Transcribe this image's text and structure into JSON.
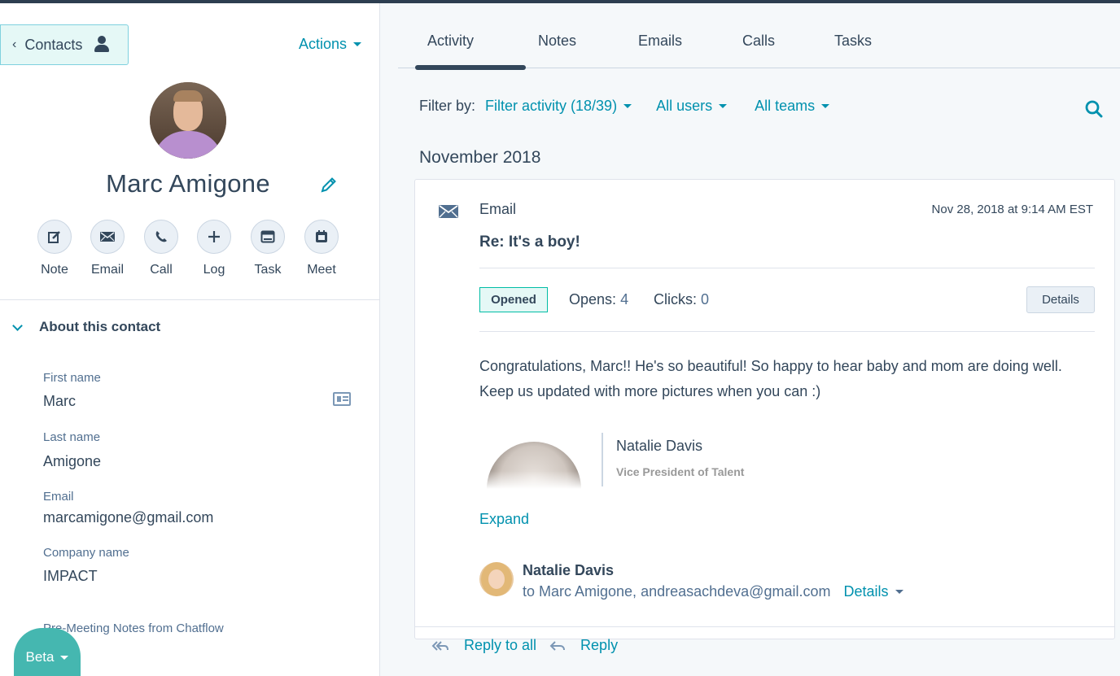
{
  "nav": {
    "back_label": "Contacts",
    "actions_label": "Actions"
  },
  "contact": {
    "name": "Marc Amigone"
  },
  "quick_actions": [
    {
      "label": "Note",
      "icon": "note-icon"
    },
    {
      "label": "Email",
      "icon": "email-icon"
    },
    {
      "label": "Call",
      "icon": "phone-icon"
    },
    {
      "label": "Log",
      "icon": "plus-icon"
    },
    {
      "label": "Task",
      "icon": "task-icon"
    },
    {
      "label": "Meet",
      "icon": "calendar-icon"
    }
  ],
  "about": {
    "heading": "About this contact",
    "fields": [
      {
        "label": "First name",
        "value": "Marc"
      },
      {
        "label": "Last name",
        "value": "Amigone"
      },
      {
        "label": "Email",
        "value": "marcamigone@gmail.com"
      },
      {
        "label": "Company name",
        "value": "IMPACT"
      },
      {
        "label": "Pre-Meeting Notes from Chatflow",
        "value": ""
      }
    ]
  },
  "beta_label": "Beta",
  "tabs": [
    "Activity",
    "Notes",
    "Emails",
    "Calls",
    "Tasks"
  ],
  "active_tab": "Activity",
  "filters": {
    "label": "Filter by:",
    "activity": "Filter activity (18/39)",
    "users": "All users",
    "teams": "All teams"
  },
  "month_heading": "November 2018",
  "email_card": {
    "type": "Email",
    "timestamp": "Nov 28, 2018 at 9:14 AM EST",
    "subject": "Re: It's a boy!",
    "status": "Opened",
    "opens_label": "Opens:",
    "opens_value": "4",
    "clicks_label": "Clicks:",
    "clicks_value": "0",
    "details_button": "Details",
    "body": "Congratulations, Marc!! He's so beautiful! So happy to hear baby and mom are doing well. Keep us updated with more pictures when you can :)",
    "signature": {
      "name": "Natalie Davis",
      "title": "Vice President of Talent"
    },
    "expand_label": "Expand",
    "sender": {
      "name": "Natalie Davis",
      "recipients": "to Marc Amigone, andreasachdeva@gmail.com",
      "details_label": "Details"
    },
    "reply_all_label": "Reply to all",
    "reply_label": "Reply"
  },
  "colors": {
    "accent": "#0091ae",
    "text": "#33475b",
    "opened_border": "#00bda5"
  }
}
